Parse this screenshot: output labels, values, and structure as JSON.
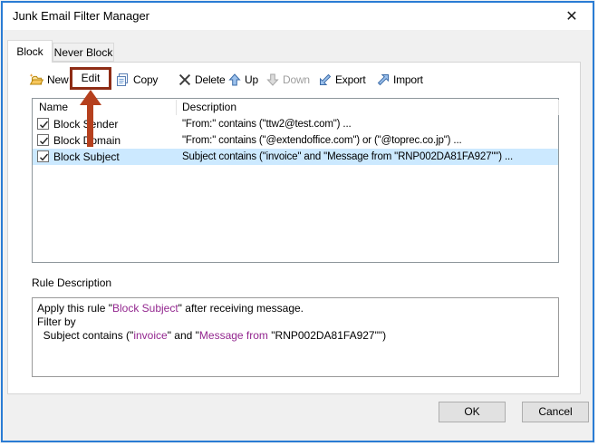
{
  "window": {
    "title": "Junk Email Filter Manager",
    "close_glyph": "✕"
  },
  "tabs": {
    "block": "Block",
    "never_block": "Never Block"
  },
  "toolbar": {
    "items": {
      "new": "New",
      "edit": "Edit",
      "copy": "Copy",
      "delete": "Delete",
      "up": "Up",
      "down": "Down",
      "export": "Export",
      "import": "Import"
    },
    "disabled_item": "Down",
    "highlight_box_color": "#8e2c15",
    "arrow_color": "#b5401e"
  },
  "list": {
    "columns": {
      "name": "Name",
      "description": "Description"
    },
    "rows": [
      {
        "name": "Block Sender",
        "checked": true,
        "selected": false,
        "description": "\"From:\" contains (\"ttw2@test.com\") ..."
      },
      {
        "name": "Block Domain",
        "checked": true,
        "selected": false,
        "description": "\"From:\" contains (\"@extendoffice.com\") or (\"@toprec.co.jp\") ..."
      },
      {
        "name": "Block Subject",
        "checked": true,
        "selected": true,
        "description": "Subject contains (\"invoice\" and \"Message from \"RNP002DA81FA927\"\") ..."
      }
    ],
    "selection_color": "#cce9ff"
  },
  "rule_description": {
    "label": "Rule Description",
    "line1": {
      "pre": "Apply this rule \"",
      "purple": "Block Subject",
      "post": "\" after receiving message."
    },
    "line2": "Filter by",
    "line3": {
      "pre": "  Subject contains (\"",
      "p1": "invoice",
      "mid": "\" and \"",
      "p2": "Message from ",
      "post": "\"RNP002DA81FA927\"\")"
    },
    "purple_color": "#93278f"
  },
  "footer": {
    "ok": "OK",
    "cancel": "Cancel"
  }
}
